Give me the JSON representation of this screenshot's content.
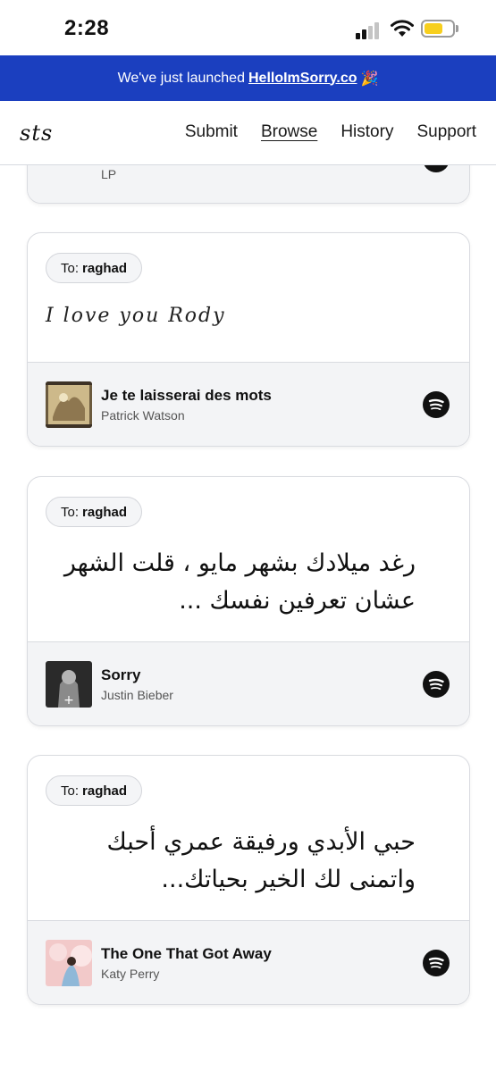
{
  "status": {
    "time": "2:28"
  },
  "banner": {
    "prefix": "We've just launched",
    "link": "HelloImSorry.co",
    "emoji": "🎉"
  },
  "nav": {
    "logo": "sts",
    "links": [
      "Submit",
      "Browse",
      "History",
      "Support"
    ],
    "active": "Browse"
  },
  "cards": [
    {
      "song": {
        "title": "",
        "artist": "LP"
      }
    },
    {
      "to_label": "To:",
      "to": "raghad",
      "message": "I love you Rody",
      "song": {
        "title": "Je te laisserai des mots",
        "artist": "Patrick Watson"
      }
    },
    {
      "to_label": "To:",
      "to": "raghad",
      "message": "رغد ميلادك بشهر مايو ، قلت الشهر عشان تعرفين نفسك ...",
      "song": {
        "title": "Sorry",
        "artist": "Justin Bieber"
      }
    },
    {
      "to_label": "To:",
      "to": "raghad",
      "message": "حبي الأبدي ورفيقة عمري أحبك واتمنى لك الخير بحياتك...",
      "song": {
        "title": "The One That Got Away",
        "artist": "Katy Perry"
      }
    }
  ],
  "colors": {
    "banner": "#1b3fbf",
    "battery": "#f7cf1e",
    "card_footer": "#f3f4f6"
  },
  "icons": [
    "signal-icon",
    "wifi-icon",
    "battery-icon",
    "spotify-icon"
  ]
}
